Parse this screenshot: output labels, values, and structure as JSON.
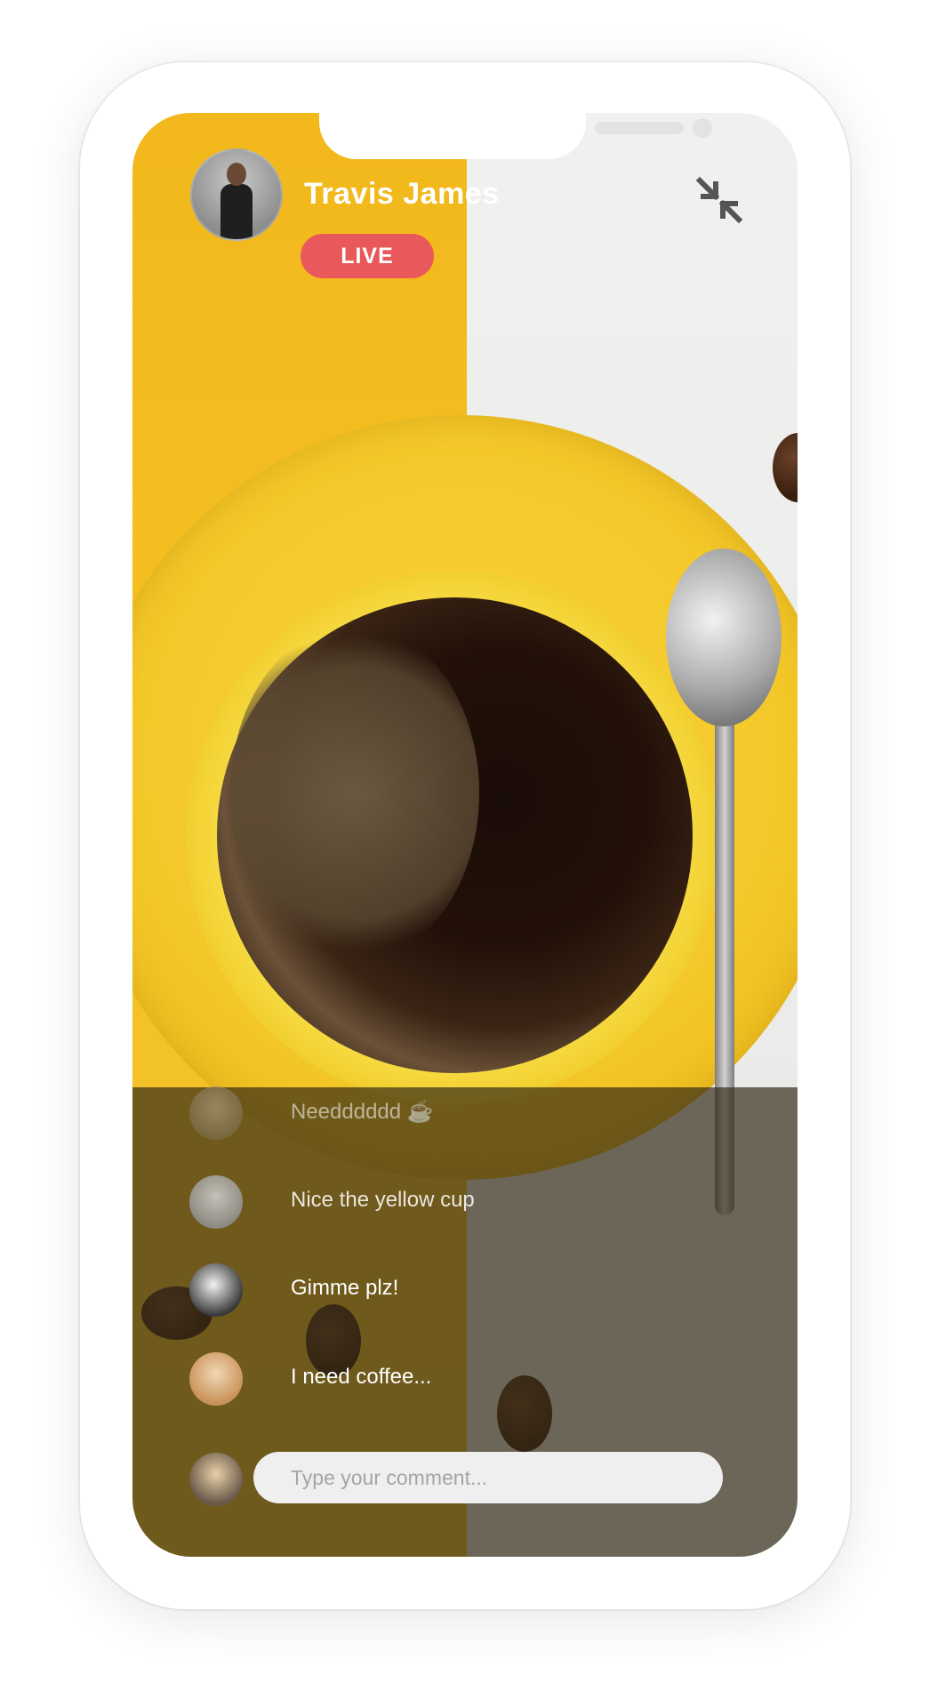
{
  "stream": {
    "host_name": "Travis James",
    "live_label": "LIVE"
  },
  "comments": [
    {
      "text": "Needddddd ☕",
      "avatar": "user-avatar-1"
    },
    {
      "text": "Nice the yellow cup",
      "avatar": "user-avatar-2"
    },
    {
      "text": "Gimme plz!",
      "avatar": "user-avatar-3"
    },
    {
      "text": "I need coffee...",
      "avatar": "user-avatar-4"
    }
  ],
  "composer": {
    "placeholder": "Type your comment..."
  },
  "icons": {
    "minimize": "minimize-icon"
  },
  "colors": {
    "live_badge": "#e9585a",
    "accent_yellow": "#f4c322"
  }
}
